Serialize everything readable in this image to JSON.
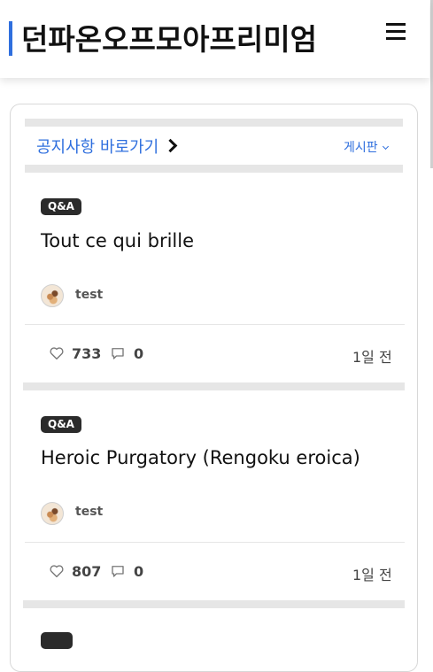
{
  "header": {
    "site_title": "던파온오프모아프리미엄",
    "menu_icon": "hamburger-menu-icon",
    "accent_color": "#2f6fde"
  },
  "notice": {
    "link_label": "공지사항 바로가기",
    "board_label": "게시판"
  },
  "posts": [
    {
      "badge": "Q&A",
      "title": "Tout ce qui brille",
      "author": "test",
      "likes": "733",
      "comments": "0",
      "time": "1일 전"
    },
    {
      "badge": "Q&A",
      "title": "Heroic Purgatory (Rengoku eroica)",
      "author": "test",
      "likes": "807",
      "comments": "0",
      "time": "1일 전"
    }
  ]
}
